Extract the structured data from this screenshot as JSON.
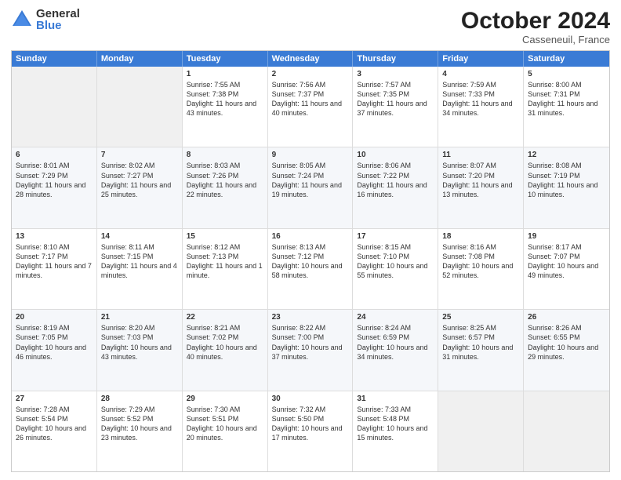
{
  "header": {
    "logo_general": "General",
    "logo_blue": "Blue",
    "month_title": "October 2024",
    "location": "Casseneuil, France"
  },
  "days_of_week": [
    "Sunday",
    "Monday",
    "Tuesday",
    "Wednesday",
    "Thursday",
    "Friday",
    "Saturday"
  ],
  "weeks": [
    [
      {
        "day": "",
        "info": ""
      },
      {
        "day": "",
        "info": ""
      },
      {
        "day": "1",
        "info": "Sunrise: 7:55 AM\nSunset: 7:38 PM\nDaylight: 11 hours and 43 minutes."
      },
      {
        "day": "2",
        "info": "Sunrise: 7:56 AM\nSunset: 7:37 PM\nDaylight: 11 hours and 40 minutes."
      },
      {
        "day": "3",
        "info": "Sunrise: 7:57 AM\nSunset: 7:35 PM\nDaylight: 11 hours and 37 minutes."
      },
      {
        "day": "4",
        "info": "Sunrise: 7:59 AM\nSunset: 7:33 PM\nDaylight: 11 hours and 34 minutes."
      },
      {
        "day": "5",
        "info": "Sunrise: 8:00 AM\nSunset: 7:31 PM\nDaylight: 11 hours and 31 minutes."
      }
    ],
    [
      {
        "day": "6",
        "info": "Sunrise: 8:01 AM\nSunset: 7:29 PM\nDaylight: 11 hours and 28 minutes."
      },
      {
        "day": "7",
        "info": "Sunrise: 8:02 AM\nSunset: 7:27 PM\nDaylight: 11 hours and 25 minutes."
      },
      {
        "day": "8",
        "info": "Sunrise: 8:03 AM\nSunset: 7:26 PM\nDaylight: 11 hours and 22 minutes."
      },
      {
        "day": "9",
        "info": "Sunrise: 8:05 AM\nSunset: 7:24 PM\nDaylight: 11 hours and 19 minutes."
      },
      {
        "day": "10",
        "info": "Sunrise: 8:06 AM\nSunset: 7:22 PM\nDaylight: 11 hours and 16 minutes."
      },
      {
        "day": "11",
        "info": "Sunrise: 8:07 AM\nSunset: 7:20 PM\nDaylight: 11 hours and 13 minutes."
      },
      {
        "day": "12",
        "info": "Sunrise: 8:08 AM\nSunset: 7:19 PM\nDaylight: 11 hours and 10 minutes."
      }
    ],
    [
      {
        "day": "13",
        "info": "Sunrise: 8:10 AM\nSunset: 7:17 PM\nDaylight: 11 hours and 7 minutes."
      },
      {
        "day": "14",
        "info": "Sunrise: 8:11 AM\nSunset: 7:15 PM\nDaylight: 11 hours and 4 minutes."
      },
      {
        "day": "15",
        "info": "Sunrise: 8:12 AM\nSunset: 7:13 PM\nDaylight: 11 hours and 1 minute."
      },
      {
        "day": "16",
        "info": "Sunrise: 8:13 AM\nSunset: 7:12 PM\nDaylight: 10 hours and 58 minutes."
      },
      {
        "day": "17",
        "info": "Sunrise: 8:15 AM\nSunset: 7:10 PM\nDaylight: 10 hours and 55 minutes."
      },
      {
        "day": "18",
        "info": "Sunrise: 8:16 AM\nSunset: 7:08 PM\nDaylight: 10 hours and 52 minutes."
      },
      {
        "day": "19",
        "info": "Sunrise: 8:17 AM\nSunset: 7:07 PM\nDaylight: 10 hours and 49 minutes."
      }
    ],
    [
      {
        "day": "20",
        "info": "Sunrise: 8:19 AM\nSunset: 7:05 PM\nDaylight: 10 hours and 46 minutes."
      },
      {
        "day": "21",
        "info": "Sunrise: 8:20 AM\nSunset: 7:03 PM\nDaylight: 10 hours and 43 minutes."
      },
      {
        "day": "22",
        "info": "Sunrise: 8:21 AM\nSunset: 7:02 PM\nDaylight: 10 hours and 40 minutes."
      },
      {
        "day": "23",
        "info": "Sunrise: 8:22 AM\nSunset: 7:00 PM\nDaylight: 10 hours and 37 minutes."
      },
      {
        "day": "24",
        "info": "Sunrise: 8:24 AM\nSunset: 6:59 PM\nDaylight: 10 hours and 34 minutes."
      },
      {
        "day": "25",
        "info": "Sunrise: 8:25 AM\nSunset: 6:57 PM\nDaylight: 10 hours and 31 minutes."
      },
      {
        "day": "26",
        "info": "Sunrise: 8:26 AM\nSunset: 6:55 PM\nDaylight: 10 hours and 29 minutes."
      }
    ],
    [
      {
        "day": "27",
        "info": "Sunrise: 7:28 AM\nSunset: 5:54 PM\nDaylight: 10 hours and 26 minutes."
      },
      {
        "day": "28",
        "info": "Sunrise: 7:29 AM\nSunset: 5:52 PM\nDaylight: 10 hours and 23 minutes."
      },
      {
        "day": "29",
        "info": "Sunrise: 7:30 AM\nSunset: 5:51 PM\nDaylight: 10 hours and 20 minutes."
      },
      {
        "day": "30",
        "info": "Sunrise: 7:32 AM\nSunset: 5:50 PM\nDaylight: 10 hours and 17 minutes."
      },
      {
        "day": "31",
        "info": "Sunrise: 7:33 AM\nSunset: 5:48 PM\nDaylight: 10 hours and 15 minutes."
      },
      {
        "day": "",
        "info": ""
      },
      {
        "day": "",
        "info": ""
      }
    ]
  ]
}
